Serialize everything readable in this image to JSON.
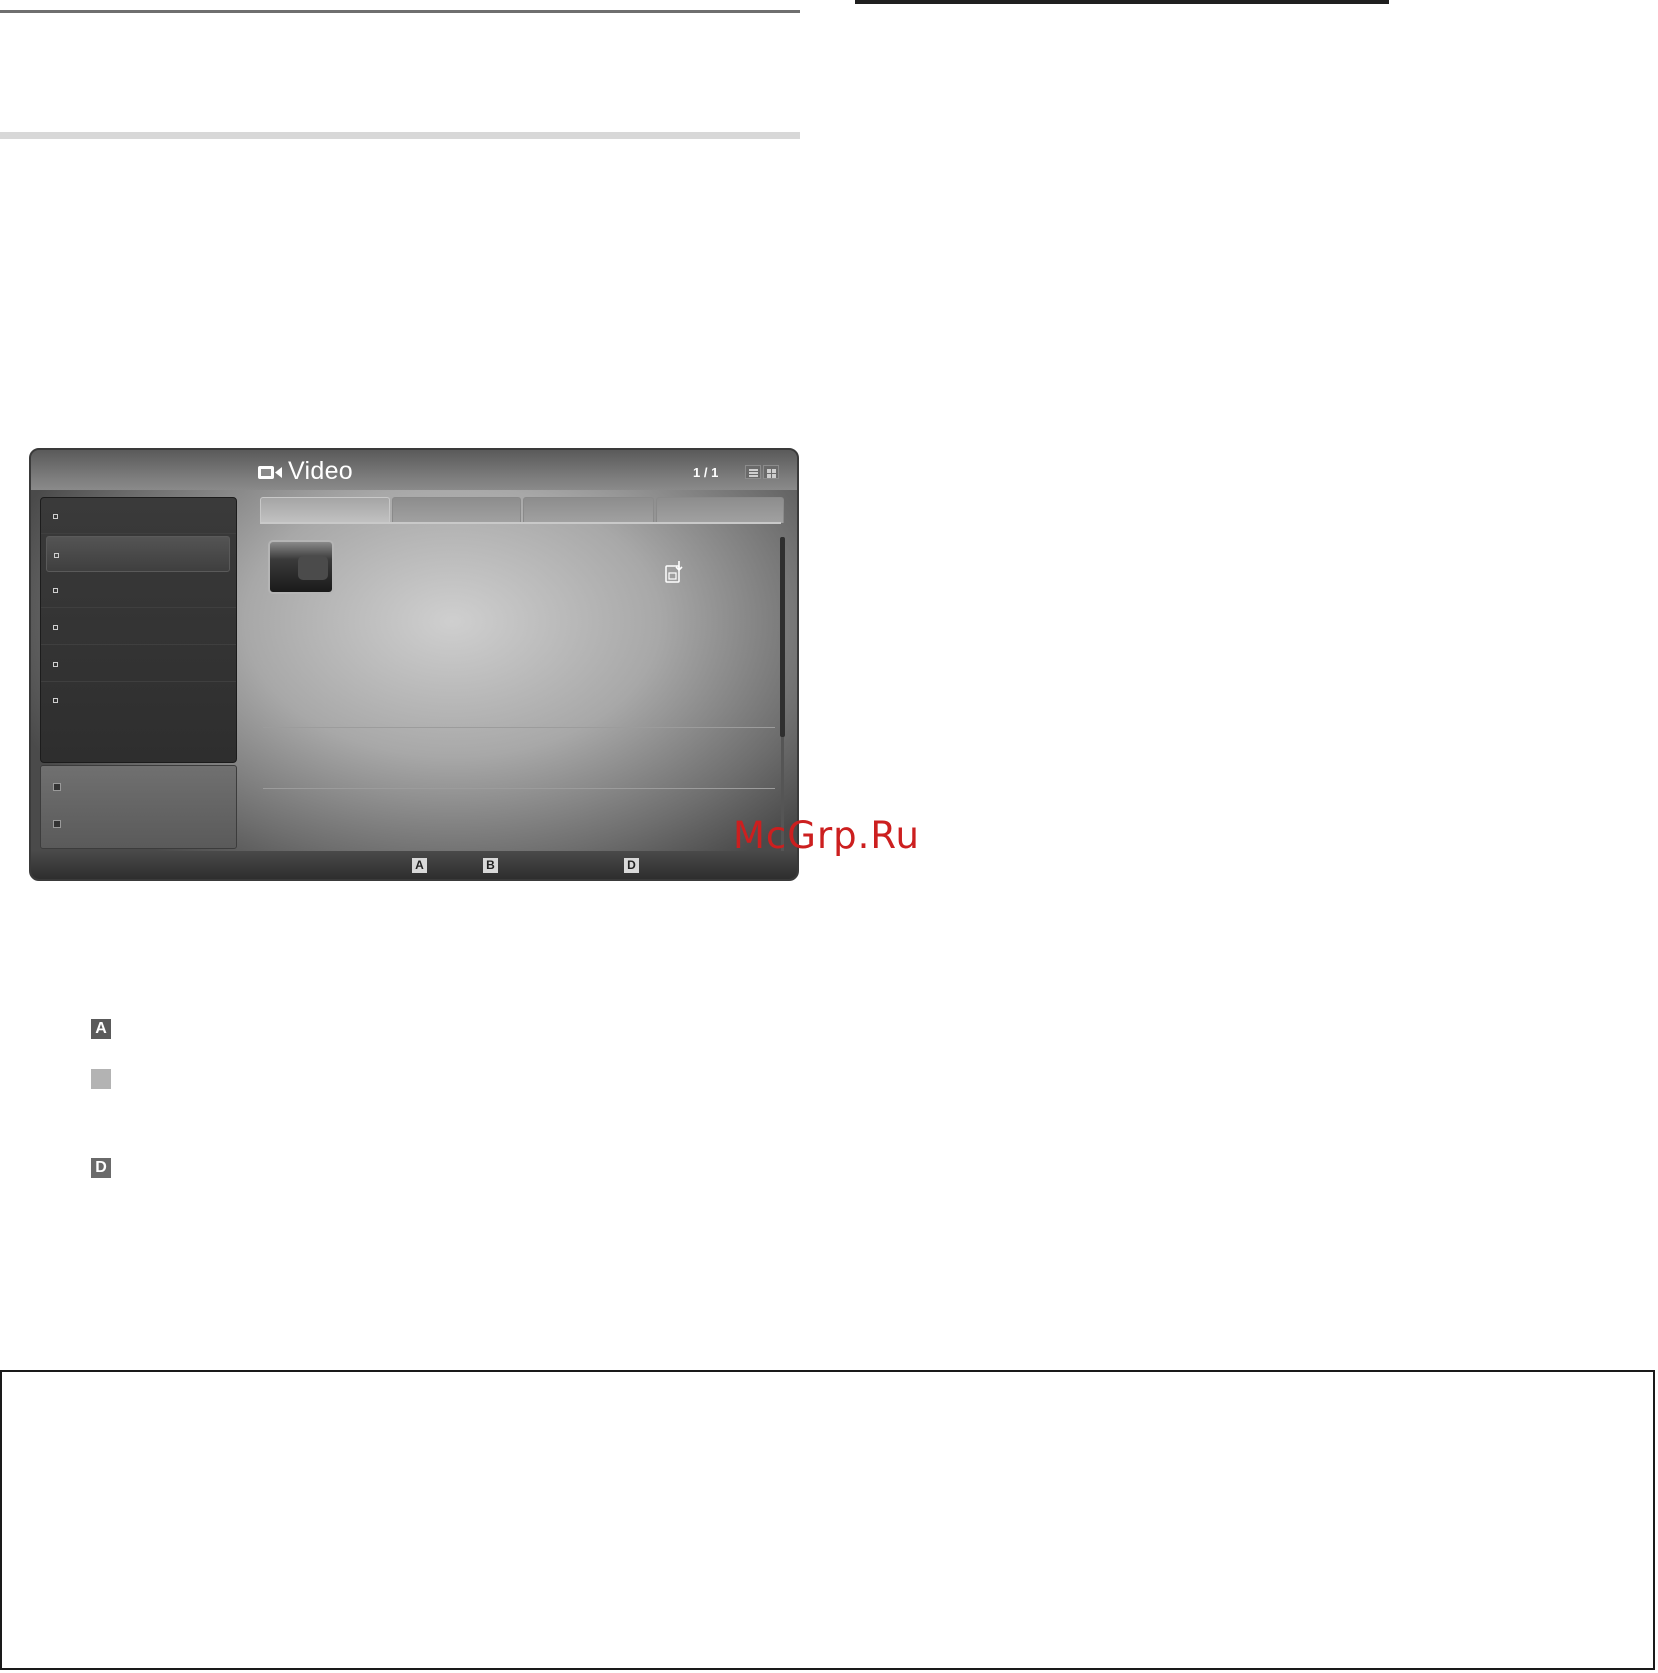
{
  "screen": {
    "title": "Video",
    "page_counter": "1 / 1",
    "view_modes": [
      "list-view",
      "grid-view"
    ],
    "sidebar_item_count": 6,
    "device_item_count": 2,
    "tab_count": 4,
    "footer_keys": [
      "A",
      "B",
      "D"
    ]
  },
  "legend": {
    "keys": [
      "A",
      "",
      "D"
    ]
  },
  "watermark": "McGrp.Ru",
  "colors": {
    "watermark": "#cc1f1f",
    "screen_dark": "#2c2c2c",
    "screen_light": "#cfcfcf"
  }
}
